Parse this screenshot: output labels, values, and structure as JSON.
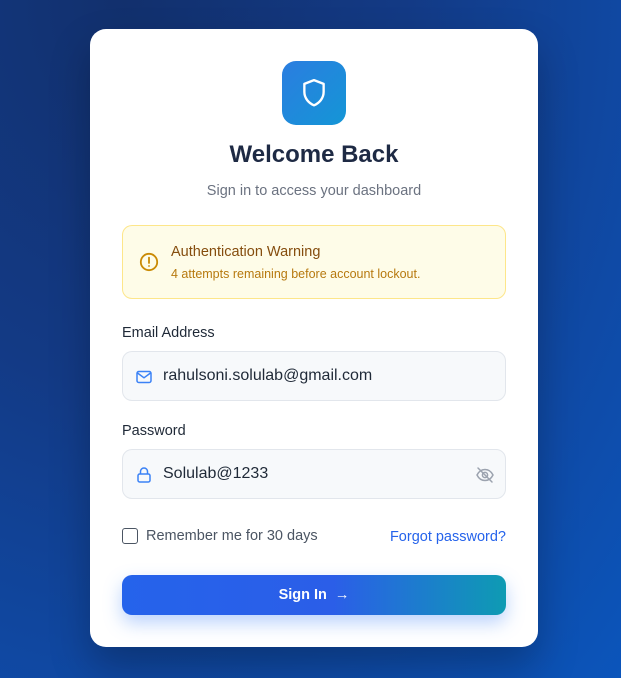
{
  "header": {
    "logo_icon": "shield-icon",
    "title": "Welcome Back",
    "subtitle": "Sign in to access your dashboard"
  },
  "alert": {
    "icon": "alert-circle-icon",
    "title": "Authentication Warning",
    "message": "4 attempts remaining before account lockout."
  },
  "form": {
    "email": {
      "label": "Email Address",
      "value": "rahulsoni.solulab@gmail.com",
      "icon": "mail-icon"
    },
    "password": {
      "label": "Password",
      "value": "Solulab@1233",
      "icon": "lock-icon",
      "toggle_icon": "eye-off-icon"
    },
    "remember_label": "Remember me for 30 days",
    "remember_checked": false,
    "forgot_label": "Forgot password?",
    "submit_label": "Sign In",
    "submit_arrow": "→"
  },
  "colors": {
    "primary": "#2563eb",
    "accent": "#0e9bb3",
    "warning_bg": "#fefce8",
    "warning_text": "#854d0e",
    "background": "#133a85"
  }
}
